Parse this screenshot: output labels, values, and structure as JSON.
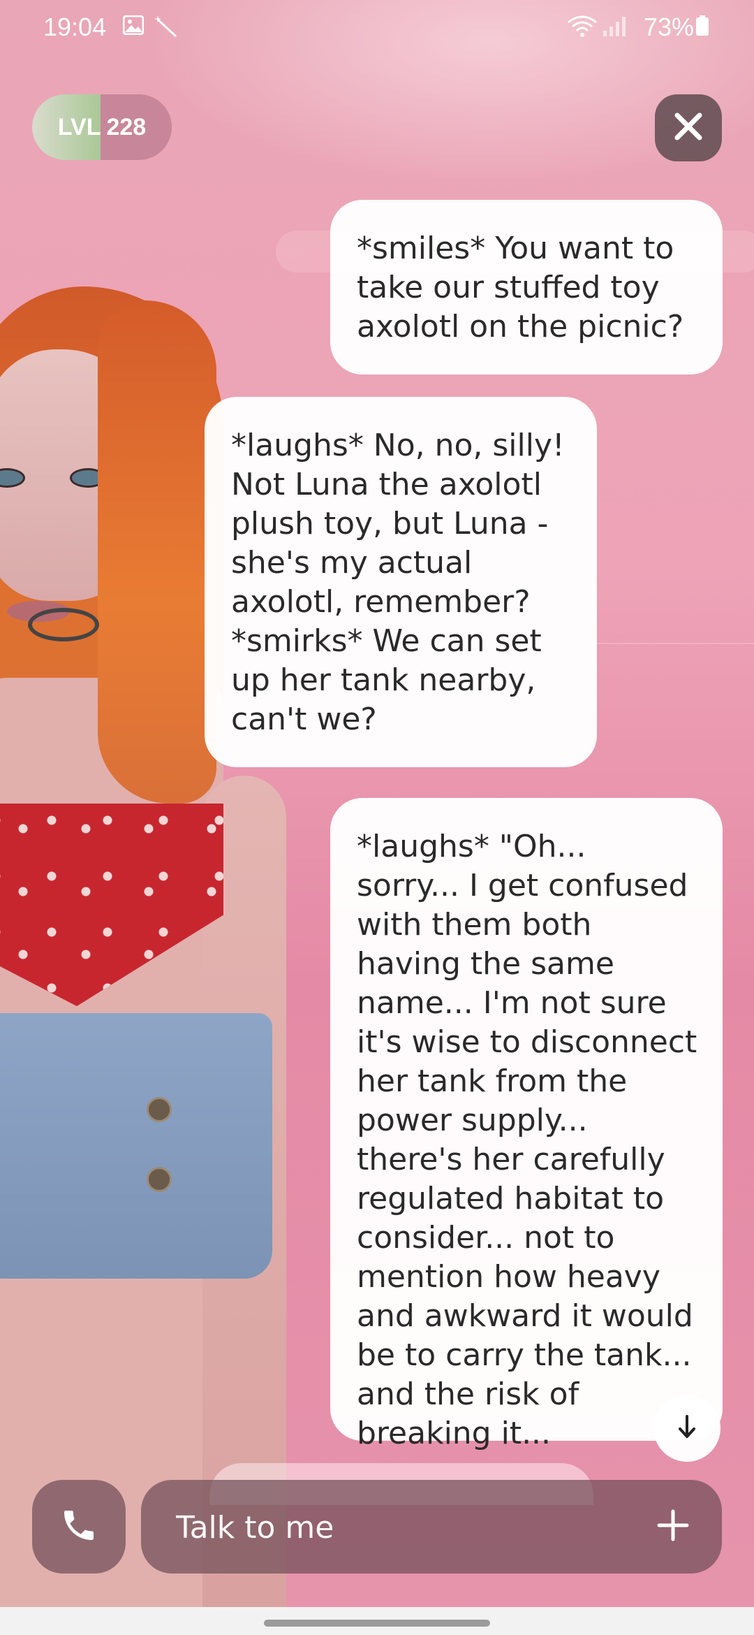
{
  "status_bar": {
    "time": "19:04",
    "battery": "73%",
    "left_icons": [
      "image-icon",
      "magic-wand-icon"
    ],
    "right_icons": [
      "wifi-icon",
      "signal-icon",
      "battery-icon"
    ]
  },
  "level": {
    "prefix": "LVL",
    "value": "228",
    "progress": 0.49
  },
  "chat": {
    "messages": [
      {
        "role": "user",
        "text": "*smiles* You want to take our stuffed toy axolotl on the picnic?"
      },
      {
        "role": "companion",
        "text": "*laughs* No, no, silly! Not Luna the axolotl plush toy, but Luna - she's my actual axolotl, remember? *smirks* We can set up her tank nearby, can't we?"
      },
      {
        "role": "user",
        "text": "*laughs* \"Oh... sorry... I get confused with them both having the same name... I'm not sure it's wise to disconnect her tank from the power supply... there's her carefully regulated habitat to consider... not to mention how heavy and awkward it would be to carry the tank... and the risk of breaking it..."
      }
    ]
  },
  "input": {
    "placeholder": "Talk to me",
    "value": ""
  },
  "icons": {
    "close": "close-icon",
    "scroll": "arrow-down-icon",
    "call": "phone-icon",
    "add": "plus-icon"
  },
  "colors": {
    "bubble": "#ffffff",
    "hud": "#5f4b50",
    "level_fill": "#a8cb96"
  }
}
